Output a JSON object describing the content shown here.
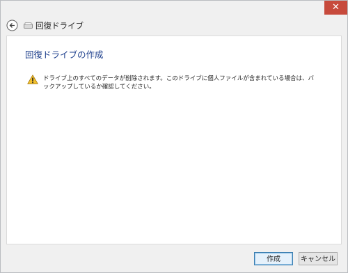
{
  "window": {
    "close_glyph": "✕",
    "accent_close": "#c74a3c"
  },
  "nav": {
    "title": "回復ドライブ",
    "back_icon": "back-arrow-icon",
    "drive_icon": "drive-icon"
  },
  "page": {
    "title": "回復ドライブの作成",
    "warning_icon": "warning-icon",
    "warning_text": "ドライブ上のすべてのデータが削除されます。このドライブに個人ファイルが含まれている場合は、バックアップしているか確認してください。"
  },
  "footer": {
    "create_label": "作成",
    "cancel_label": "キャンセル"
  }
}
